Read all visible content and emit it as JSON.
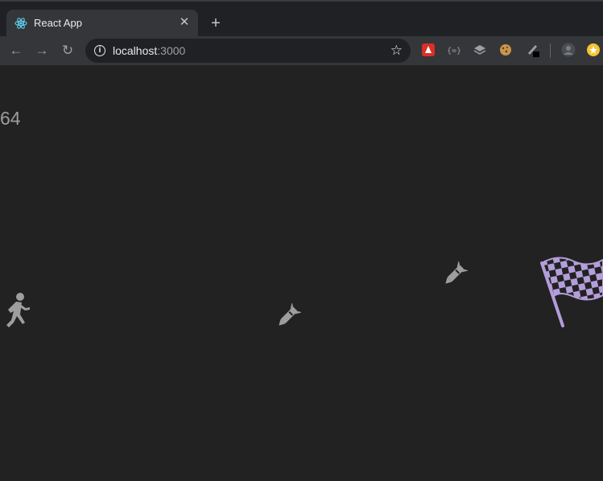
{
  "browser": {
    "tab": {
      "title": "React App",
      "close_icon": "close-icon"
    },
    "new_tab_icon": "plus-icon",
    "url_host": "localhost",
    "url_port": ":3000",
    "nav": {
      "back_icon": "arrow-left-icon",
      "forward_icon": "arrow-right-icon",
      "reload_icon": "reload-icon"
    },
    "extensions": [
      "extension-red-icon",
      "extension-json-icon",
      "extension-layers-icon",
      "extension-cookie-icon",
      "extension-pen-icon",
      "profile-avatar-icon",
      "extension-yellow-icon"
    ]
  },
  "game": {
    "score": "64",
    "player_icon": "running-person-icon",
    "missile_icon": "missile-icon",
    "goal_icon": "checkered-flag-icon",
    "colors": {
      "background": "#222222",
      "sprite": "#9e9e9e",
      "flag": "#b39ddb",
      "flag_dark": "#222222"
    }
  }
}
